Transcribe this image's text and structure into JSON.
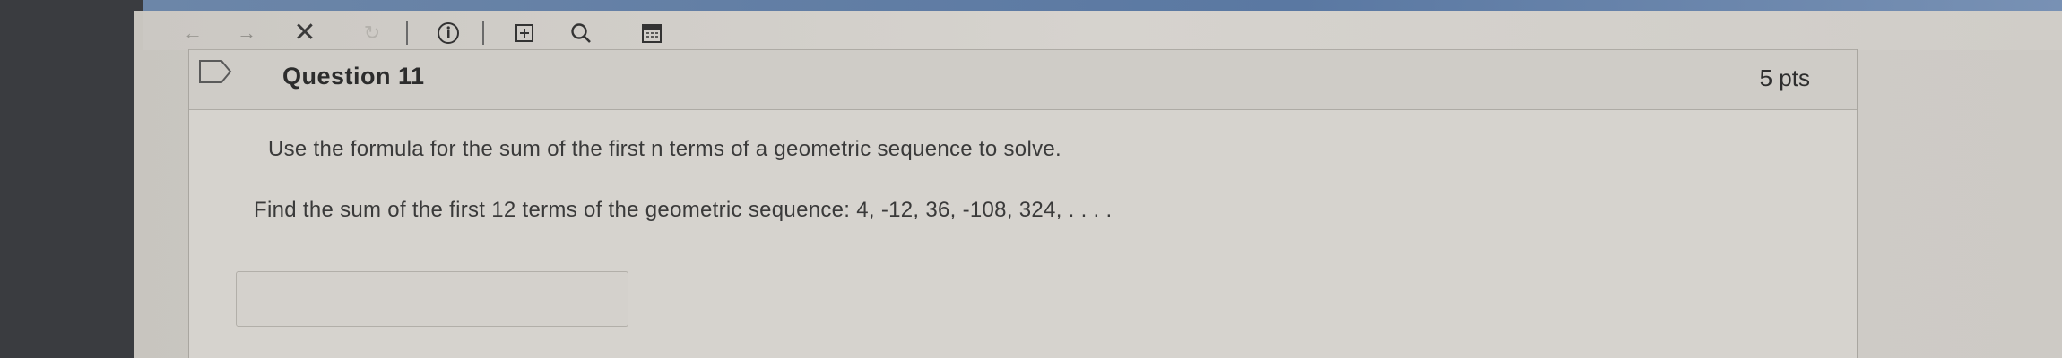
{
  "toolbar": {
    "icons": [
      "back-arrow-icon",
      "forward-arrow-icon",
      "close-icon",
      "reload-icon",
      "info-icon",
      "add-tab-icon",
      "search-icon",
      "calendar-icon"
    ]
  },
  "question": {
    "title": "Question 11",
    "points": "5 pts",
    "instruction": "Use the formula for the sum of the first n terms of a geometric sequence to solve.",
    "prompt": "Find the sum of the first 12 terms of the geometric sequence: 4, -12, 36, -108, 324, . . . .",
    "answer_value": ""
  }
}
